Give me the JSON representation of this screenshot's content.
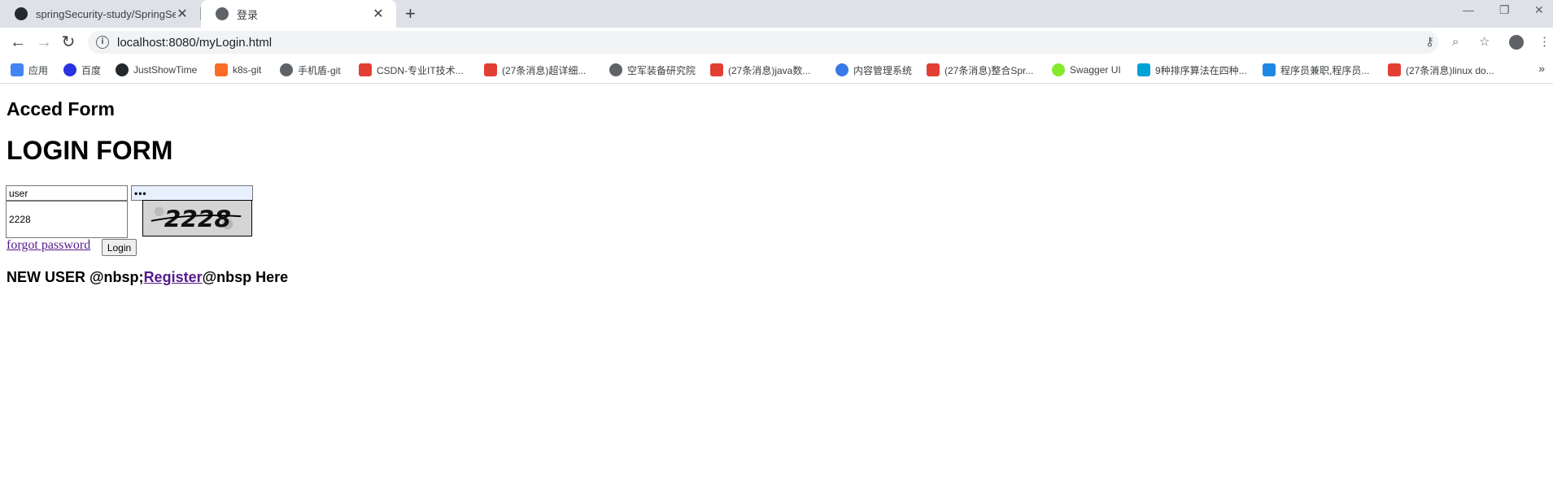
{
  "browser": {
    "tabs": [
      {
        "title": "springSecurity-study/SpringSe",
        "active": false,
        "favicon": "github-icon"
      },
      {
        "title": "登录",
        "active": true,
        "favicon": "globe-icon"
      }
    ],
    "address_bar": {
      "url": "localhost:8080/myLogin.html"
    },
    "bookmarks": [
      {
        "label": "应用",
        "icon": "apps-icon",
        "color": "#4285f4"
      },
      {
        "label": "百度",
        "icon": "baidu-icon",
        "color": "#2932e1"
      },
      {
        "label": "JustShowTime",
        "icon": "github-icon",
        "color": "#24292e"
      },
      {
        "label": "k8s-git",
        "icon": "gitlab-icon",
        "color": "#fc6d26"
      },
      {
        "label": "手机盾-git",
        "icon": "globe-icon",
        "color": "#5f6368"
      },
      {
        "label": "CSDN-专业IT技术...",
        "icon": "csdn-icon",
        "color": "#e33e33"
      },
      {
        "label": "(27条消息)超详细...",
        "icon": "csdn-icon",
        "color": "#e33e33"
      },
      {
        "label": "空军装备研究院",
        "icon": "globe-icon",
        "color": "#5f6368"
      },
      {
        "label": "(27条消息)java数...",
        "icon": "csdn-icon",
        "color": "#e33e33"
      },
      {
        "label": "内容管理系统",
        "icon": "cms-icon",
        "color": "#3b78e7"
      },
      {
        "label": "(27条消息)整合Spr...",
        "icon": "csdn-icon",
        "color": "#e33e33"
      },
      {
        "label": "Swagger UI",
        "icon": "swagger-icon",
        "color": "#85ea2d"
      },
      {
        "label": "9种排序算法在四种...",
        "icon": "bilibili-icon",
        "color": "#00a1d6"
      },
      {
        "label": "程序员兼职,程序员...",
        "icon": "terminal-icon",
        "color": "#1e88e5"
      },
      {
        "label": "(27条消息)linux do...",
        "icon": "csdn-icon",
        "color": "#e33e33"
      }
    ]
  },
  "page": {
    "heading_small": "Acced Form",
    "heading_large": "LOGIN FORM",
    "username_value": "user",
    "password_mask": "•••",
    "code_value": "2228",
    "captcha_text": "2228",
    "forgot_link": "forgot password",
    "login_button": "Login",
    "new_user_prefix": "NEW USER @nbsp;",
    "register_link": "Register",
    "new_user_suffix": "@nbsp Here"
  }
}
